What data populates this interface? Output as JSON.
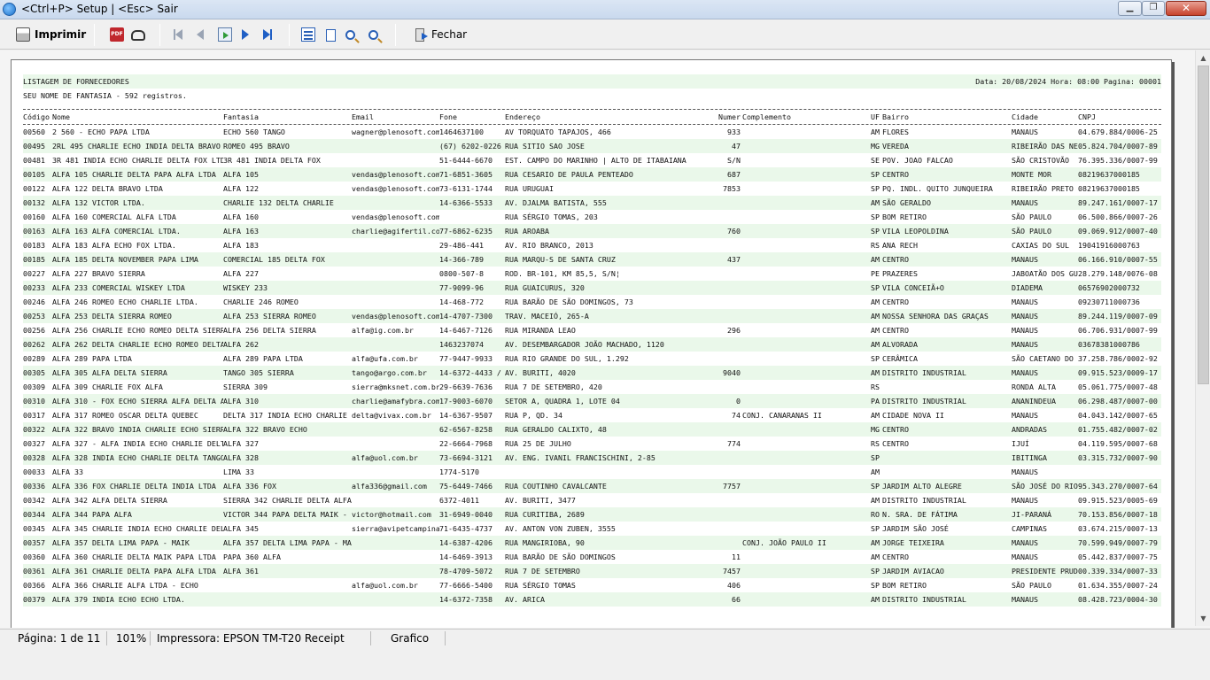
{
  "window": {
    "title": "<Ctrl+P> Setup | <Esc> Sair"
  },
  "toolbar": {
    "print_label": "Imprimir",
    "close_label": "Fechar"
  },
  "report": {
    "title": "LISTAGEM DE FORNECEDORES",
    "header_right": "Data: 20/08/2024 Hora: 08:00 Pagina: 00001",
    "subtitle": "SEU NOME DE FANTASIA - 592 registros.",
    "columns": [
      "Código",
      "Nome",
      "Fantasia",
      "Email",
      "Fone",
      "Endereço",
      "Numer",
      "Complemento",
      "UF",
      "Bairro",
      "Cidade",
      "CNPJ"
    ],
    "rows": [
      [
        "00560",
        "2 560 - ECHO PAPA LTDA",
        "ECHO 560 TANGO",
        "wagner@plenosoft.com",
        "1464637100",
        "AV TORQUATO TAPAJOS, 466",
        "933",
        "",
        "AM",
        "FLORES",
        "MANAUS",
        "04.679.884/0006-25"
      ],
      [
        "00495",
        "2RL 495 CHARLIE ECHO INDIA DELTA BRAVO H",
        "ROMEO 495 BRAVO",
        "",
        "(67) 6202-0226",
        "RUA SITIO SAO JOSE",
        "47",
        "",
        "MG",
        "VEREDA",
        "RIBEIRÃO DAS NE",
        "05.824.704/0007-89"
      ],
      [
        "00481",
        "3R 481 INDIA ECHO CHARLIE DELTA FOX LTDA",
        "3R 481 INDIA DELTA FOX",
        "",
        "51-6444-6670",
        "EST. CAMPO DO MARINHO | ALTO DE ITABAIANA",
        "S/N",
        "",
        "SE",
        "POV. JOAO FALCAO",
        "SÃO CRISTOVÃO",
        "76.395.336/0007-99"
      ],
      [
        "00105",
        "ALFA 105 CHARLIE DELTA PAPA ALFA LTDA",
        "ALFA 105",
        "vendas@plenosoft.com",
        "71-6851-3605",
        "RUA CESARIO DE PAULA PENTEADO",
        "687",
        "",
        "SP",
        "CENTRO",
        "MONTE MOR",
        "08219637000185"
      ],
      [
        "00122",
        "ALFA 122 DELTA BRAVO LTDA",
        "ALFA 122",
        "vendas@plenosoft.com",
        "73-6131-1744",
        "RUA URUGUAI",
        "7853",
        "",
        "SP",
        "PQ. INDL. QUITO JUNQUEIRA",
        "RIBEIRÃO PRETO",
        "08219637000185"
      ],
      [
        "00132",
        "ALFA 132 VICTOR LTDA.",
        "CHARLIE 132 DELTA CHARLIE",
        "",
        "14-6366-5533",
        "AV. DJALMA BATISTA, 555",
        "",
        "",
        "AM",
        "SÃO GERALDO",
        "MANAUS",
        "89.247.161/0007-17"
      ],
      [
        "00160",
        "ALFA 160 COMERCIAL ALFA LTDA",
        "ALFA 160",
        "vendas@plenosoft.com",
        "",
        "RUA SÉRGIO TOMAS, 203",
        "",
        "",
        "SP",
        "BOM RETIRO",
        "SÃO PAULO",
        "06.500.866/0007-26"
      ],
      [
        "00163",
        "ALFA 163 ALFA COMERCIAL LTDA.",
        "ALFA 163",
        "charlie@agifertil.co",
        "77-6862-6235",
        "RUA AROABA",
        "760",
        "",
        "SP",
        "VILA LEOPOLDINA",
        "SÃO PAULO",
        "09.069.912/0007-40"
      ],
      [
        "00183",
        "ALFA 183 ALFA ECHO FOX LTDA.",
        "ALFA 183",
        "",
        "29-486-441",
        "AV. RIO BRANCO, 2013",
        "",
        "",
        "RS",
        "ANA RECH",
        "CAXIAS DO SUL",
        "19041916000763"
      ],
      [
        "00185",
        "ALFA 185 DELTA NOVEMBER PAPA LIMA",
        "COMERCIAL 185 DELTA FOX",
        "",
        "14-366-789",
        "RUA MARQU-S DE SANTA CRUZ",
        "437",
        "",
        "AM",
        "CENTRO",
        "MANAUS",
        "06.166.910/0007-55"
      ],
      [
        "00227",
        "ALFA 227 BRAVO SIERRA",
        "ALFA 227",
        "",
        "0800-507-8",
        "ROD. BR-101, KM 85,5, S/N¦",
        "",
        "",
        "PE",
        "PRAZERES",
        "JABOATÃO DOS GU",
        "28.279.148/0076-08"
      ],
      [
        "00233",
        "ALFA 233 COMERCIAL WISKEY LTDA",
        "WISKEY 233",
        "",
        "77-9099-96",
        "RUA GUAICURUS, 320",
        "",
        "",
        "SP",
        "VILA CONCEIÃ+O",
        "DIADEMA",
        "06576902000732"
      ],
      [
        "00246",
        "ALFA 246 ROMEO ECHO CHARLIE LTDA.",
        "CHARLIE 246 ROMEO",
        "",
        "14-468-772",
        "RUA BARÃO DE SÃO DOMINGOS, 73",
        "",
        "",
        "AM",
        "CENTRO",
        "MANAUS",
        "09230711000736"
      ],
      [
        "00253",
        "ALFA 253 DELTA SIERRA ROMEO",
        "ALFA 253 SIERRA ROMEO",
        "vendas@plenosoft.com",
        "14-4707-7300",
        "TRAV. MACEIÓ, 265-A",
        "",
        "",
        "AM",
        "NOSSA SENHORA DAS GRAÇAS",
        "MANAUS",
        "89.244.119/0007-09"
      ],
      [
        "00256",
        "ALFA 256 CHARLIE ECHO ROMEO DELTA SIERRA",
        "ALFA 256 DELTA SIERRA",
        "alfa@ig.com.br",
        "14-6467-7126",
        "RUA MIRANDA LEAO",
        "296",
        "",
        "AM",
        "CENTRO",
        "MANAUS",
        "06.706.931/0007-99"
      ],
      [
        "00262",
        "ALFA 262 DELTA CHARLIE ECHO ROMEO DELTA",
        "ALFA 262",
        "",
        "1463237074",
        "AV. DESEMBARGADOR JOÃO MACHADO, 1120",
        "",
        "",
        "AM",
        "ALVORADA",
        "MANAUS",
        "03678381000786"
      ],
      [
        "00289",
        "ALFA 289 PAPA LTDA",
        "ALFA 289 PAPA LTDA",
        "alfa@ufa.com.br",
        "77-9447-9933",
        "RUA RIO GRANDE DO SUL, 1.292",
        "",
        "",
        "SP",
        "CERÂMICA",
        "SÃO CAETANO DO",
        "37.258.786/0002-92"
      ],
      [
        "00305",
        "ALFA 305 ALFA DELTA SIERRA",
        "TANGO 305 SIERRA",
        "tango@argo.com.br",
        "14-6372-4433 /",
        "AV. BURITI, 4020",
        "9040",
        "",
        "AM",
        "DISTRITO INDUSTRIAL",
        "MANAUS",
        "09.915.523/0009-17"
      ],
      [
        "00309",
        "ALFA 309 CHARLIE FOX ALFA",
        "SIERRA 309",
        "sierra@mksnet.com.br",
        "29-6639-7636",
        "RUA 7 DE SETEMBRO, 420",
        "",
        "",
        "RS",
        "",
        "RONDA ALTA",
        "05.061.775/0007-48"
      ],
      [
        "00310",
        "ALFA 310 - FOX ECHO SIERRA ALFA DELTA AL",
        "ALFA 310",
        "charlie@amafybra.com",
        "17-9003-6070",
        "SETOR A, QUADRA 1, LOTE 04",
        "0",
        "",
        "PA",
        "DISTRITO INDUSTRIAL",
        "ANANINDEUA",
        "06.298.487/0007-00"
      ],
      [
        "00317",
        "ALFA 317 ROMEO OSCAR DELTA QUEBEC",
        "DELTA 317 INDIA ECHO CHARLIE D",
        "delta@vivax.com.br",
        "14-6367-9507",
        "RUA P, QD. 34",
        "74",
        "CONJ. CANARANAS II",
        "AM",
        "CIDADE NOVA II",
        "MANAUS",
        "04.043.142/0007-65"
      ],
      [
        "00322",
        "ALFA 322 BRAVO INDIA CHARLIE ECHO SIERRA",
        "ALFA 322 BRAVO ECHO",
        "",
        "62-6567-8258",
        "RUA GERALDO CALIXTO, 48",
        "",
        "",
        "MG",
        "CENTRO",
        "ANDRADAS",
        "01.755.482/0007-02"
      ],
      [
        "00327",
        "ALFA 327 - ALFA INDIA ECHO CHARLIE DELTA",
        "ALFA 327",
        "",
        "22-6664-7968",
        "RUA 25 DE JULHO",
        "774",
        "",
        "RS",
        "CENTRO",
        "IJUÍ",
        "04.119.595/0007-68"
      ],
      [
        "00328",
        "ALFA 328 INDIA ECHO CHARLIE DELTA TANGO",
        "ALFA 328",
        "alfa@uol.com.br",
        "73-6694-3121",
        "AV. ENG. IVANIL FRANCISCHINI, 2-85",
        "",
        "",
        "SP",
        "",
        "IBITINGA",
        "03.315.732/0007-90"
      ],
      [
        "00033",
        "ALFA 33",
        "LIMA 33",
        "",
        "1774-5170",
        "",
        "",
        "",
        "AM",
        "",
        "MANAUS",
        ""
      ],
      [
        "00336",
        "ALFA 336 FOX CHARLIE DELTA INDIA LTDA",
        "ALFA 336 FOX",
        "alfa336@gmail.com",
        "75-6449-7466",
        "RUA COUTINHO CAVALCANTE",
        "7757",
        "",
        "SP",
        "JARDIM ALTO ALEGRE",
        "SÃO JOSÉ DO RIO",
        "95.343.270/0007-64"
      ],
      [
        "00342",
        "ALFA 342 ALFA DELTA SIERRA",
        "SIERRA 342 CHARLIE DELTA ALFA",
        "",
        "6372-4011",
        "AV. BURITI, 3477",
        "",
        "",
        "AM",
        "DISTRITO INDUSTRIAL",
        "MANAUS",
        "09.915.523/0005-69"
      ],
      [
        "00344",
        "ALFA 344 PAPA ALFA",
        "VICTOR 344 PAPA DELTA MAIK - M",
        "victor@hotmail.com",
        "31-6949-0040",
        "RUA CURITIBA, 2689",
        "",
        "",
        "RO",
        "N. SRA. DE FÁTIMA",
        "JI-PARANÁ",
        "70.153.856/0007-18"
      ],
      [
        "00345",
        "ALFA 345 CHARLIE INDIA ECHO CHARLIE DELT",
        "ALFA 345",
        "sierra@avipetcampina",
        "71-6435-4737",
        "AV. ANTON VON ZUBEN, 3555",
        "",
        "",
        "SP",
        "JARDIM SÃO JOSÉ",
        "CAMPINAS",
        "03.674.215/0007-13"
      ],
      [
        "00357",
        "ALFA 357 DELTA LIMA PAPA - MAIK",
        "ALFA 357 DELTA LIMA PAPA - MAI",
        "",
        "14-6387-4206",
        "RUA MANGIRIOBA, 90",
        "",
        "CONJ. JOÃO PAULO II",
        "AM",
        "JORGE TEIXEIRA",
        "MANAUS",
        "70.599.949/0007-79"
      ],
      [
        "00360",
        "ALFA 360 CHARLIE DELTA MAIK PAPA LTDA",
        "PAPA 360 ALFA",
        "",
        "14-6469-3913",
        "RUA BARÃO DE SÃO DOMINGOS",
        "11",
        "",
        "AM",
        "CENTRO",
        "MANAUS",
        "05.442.837/0007-75"
      ],
      [
        "00361",
        "ALFA 361 CHARLIE DELTA PAPA ALFA LTDA",
        "ALFA 361",
        "",
        "78-4709-5072",
        "RUA 7 DE SETEMBRO",
        "7457",
        "",
        "SP",
        "JARDIM AVIACAO",
        "PRESIDENTE PRUD",
        "00.339.334/0007-33"
      ],
      [
        "00366",
        "ALFA 366 CHARLIE ALFA LTDA - ECHO",
        "",
        "alfa@uol.com.br",
        "77-6666-5400",
        "RUA SÉRGIO TOMAS",
        "406",
        "",
        "SP",
        "BOM RETIRO",
        "SÃO PAULO",
        "01.634.355/0007-24"
      ],
      [
        "00379",
        "ALFA 379 INDIA ECHO ECHO LTDA.",
        "",
        "",
        "14-6372-7358",
        "AV. ARICA",
        "66",
        "",
        "AM",
        "DISTRITO INDUSTRIAL",
        "MANAUS",
        "08.428.723/0004-30"
      ]
    ]
  },
  "statusbar": {
    "page": "Página: 1 de 11",
    "zoom": "101%",
    "printer": "Impressora: EPSON TM-T20 Receipt",
    "mode": "Grafico"
  },
  "colors": {
    "row_band": "#eaf8ea",
    "title_bar": "#c9d9ee",
    "close_button": "#c7422c"
  }
}
